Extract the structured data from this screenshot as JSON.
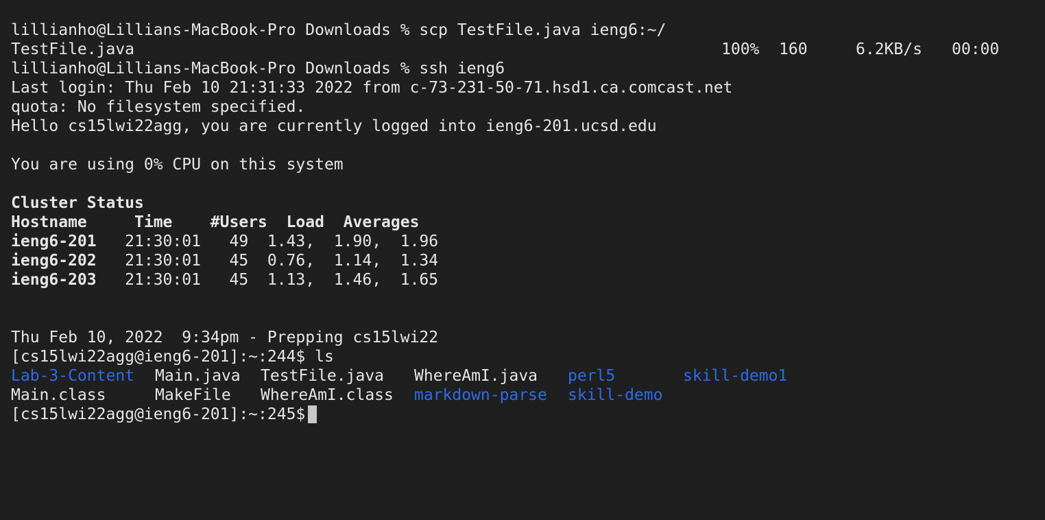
{
  "terminal": {
    "lines": {
      "cmd_scp": "lillianho@Lillians-MacBook-Pro Downloads % scp TestFile.java ieng6:~/",
      "cmd_ssh": "lillianho@Lillians-MacBook-Pro Downloads % ssh ieng6",
      "last_login": "Last login: Thu Feb 10 21:31:33 2022 from c-73-231-50-71.hsd1.ca.comcast.net",
      "quota": "quota: No filesystem specified.",
      "hello": "Hello cs15lwi22agg, you are currently logged into ieng6-201.ucsd.edu",
      "cpu": "You are using 0% CPU on this system",
      "date_line": "Thu Feb 10, 2022  9:34pm - Prepping cs15lwi22"
    },
    "transfer": {
      "file": "TestFile.java",
      "percent": "100%",
      "bytes": "160",
      "rate": "6.2KB/s",
      "eta": "00:00"
    },
    "cluster": {
      "title": "Cluster Status",
      "header": "Hostname     Time    #Users  Load  Averages",
      "rows": [
        {
          "host": "ieng6-201",
          "rest": "   21:30:01   49  1.43,  1.90,  1.96"
        },
        {
          "host": "ieng6-202",
          "rest": "   21:30:01   45  0.76,  1.14,  1.34"
        },
        {
          "host": "ieng6-203",
          "rest": "   21:30:01   45  1.13,  1.46,  1.65"
        }
      ]
    },
    "prompt_ls": "[cs15lwi22agg@ieng6-201]:~:244$ ls",
    "ls_output": {
      "row1": [
        "Lab-3-Content",
        "Main.java",
        "TestFile.java",
        "WhereAmI.java",
        "perl5",
        "skill-demo1"
      ],
      "row2": [
        "Main.class",
        "MakeFile",
        "WhereAmI.class",
        "markdown-parse",
        "skill-demo"
      ]
    },
    "prompt_current": "[cs15lwi22agg@ieng6-201]:~:245$",
    "colors": {
      "background": "#1f1f1f",
      "text": "#e6e6e6",
      "directory": "#2e6bea",
      "cursor": "#c8c8c8"
    }
  }
}
